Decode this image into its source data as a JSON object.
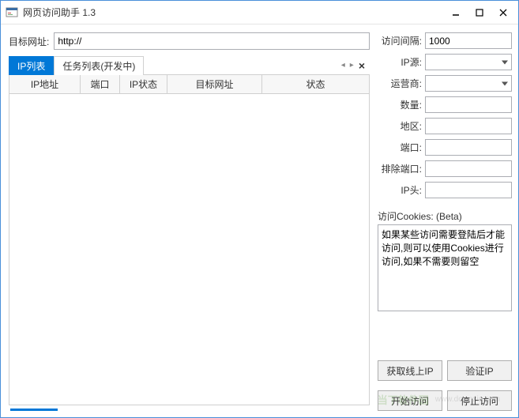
{
  "window": {
    "title": "网页访问助手 1.3"
  },
  "left": {
    "target_url_label": "目标网址:",
    "target_url_value": "http://",
    "tabs": [
      {
        "label": "IP列表",
        "active": true
      },
      {
        "label": "任务列表(开发中)",
        "active": false
      }
    ],
    "columns": {
      "ip": "IP地址",
      "port": "端口",
      "ip_status": "IP状态",
      "target": "目标网址",
      "status": "状态"
    }
  },
  "right": {
    "interval_label": "访问间隔:",
    "interval_value": "1000",
    "ip_source_label": "IP源:",
    "ip_source_value": "",
    "isp_label": "运营商:",
    "isp_value": "",
    "count_label": "数量:",
    "count_value": "",
    "region_label": "地区:",
    "region_value": "",
    "port_label": "端口:",
    "port_value": "",
    "exclude_port_label": "排除端口:",
    "exclude_port_value": "",
    "ip_head_label": "IP头:",
    "ip_head_value": "",
    "cookies_label": "访问Cookies: (Beta)",
    "cookies_value": "如果某些访问需要登陆后才能访问,则可以使用Cookies进行访问,如果不需要则留空",
    "btn_fetch": "获取线上IP",
    "btn_verify": "验证IP",
    "btn_start": "开始访问",
    "btn_stop": "停止访问"
  },
  "watermark": {
    "main": "当下软件园",
    "sub": "www.downxia.com"
  }
}
